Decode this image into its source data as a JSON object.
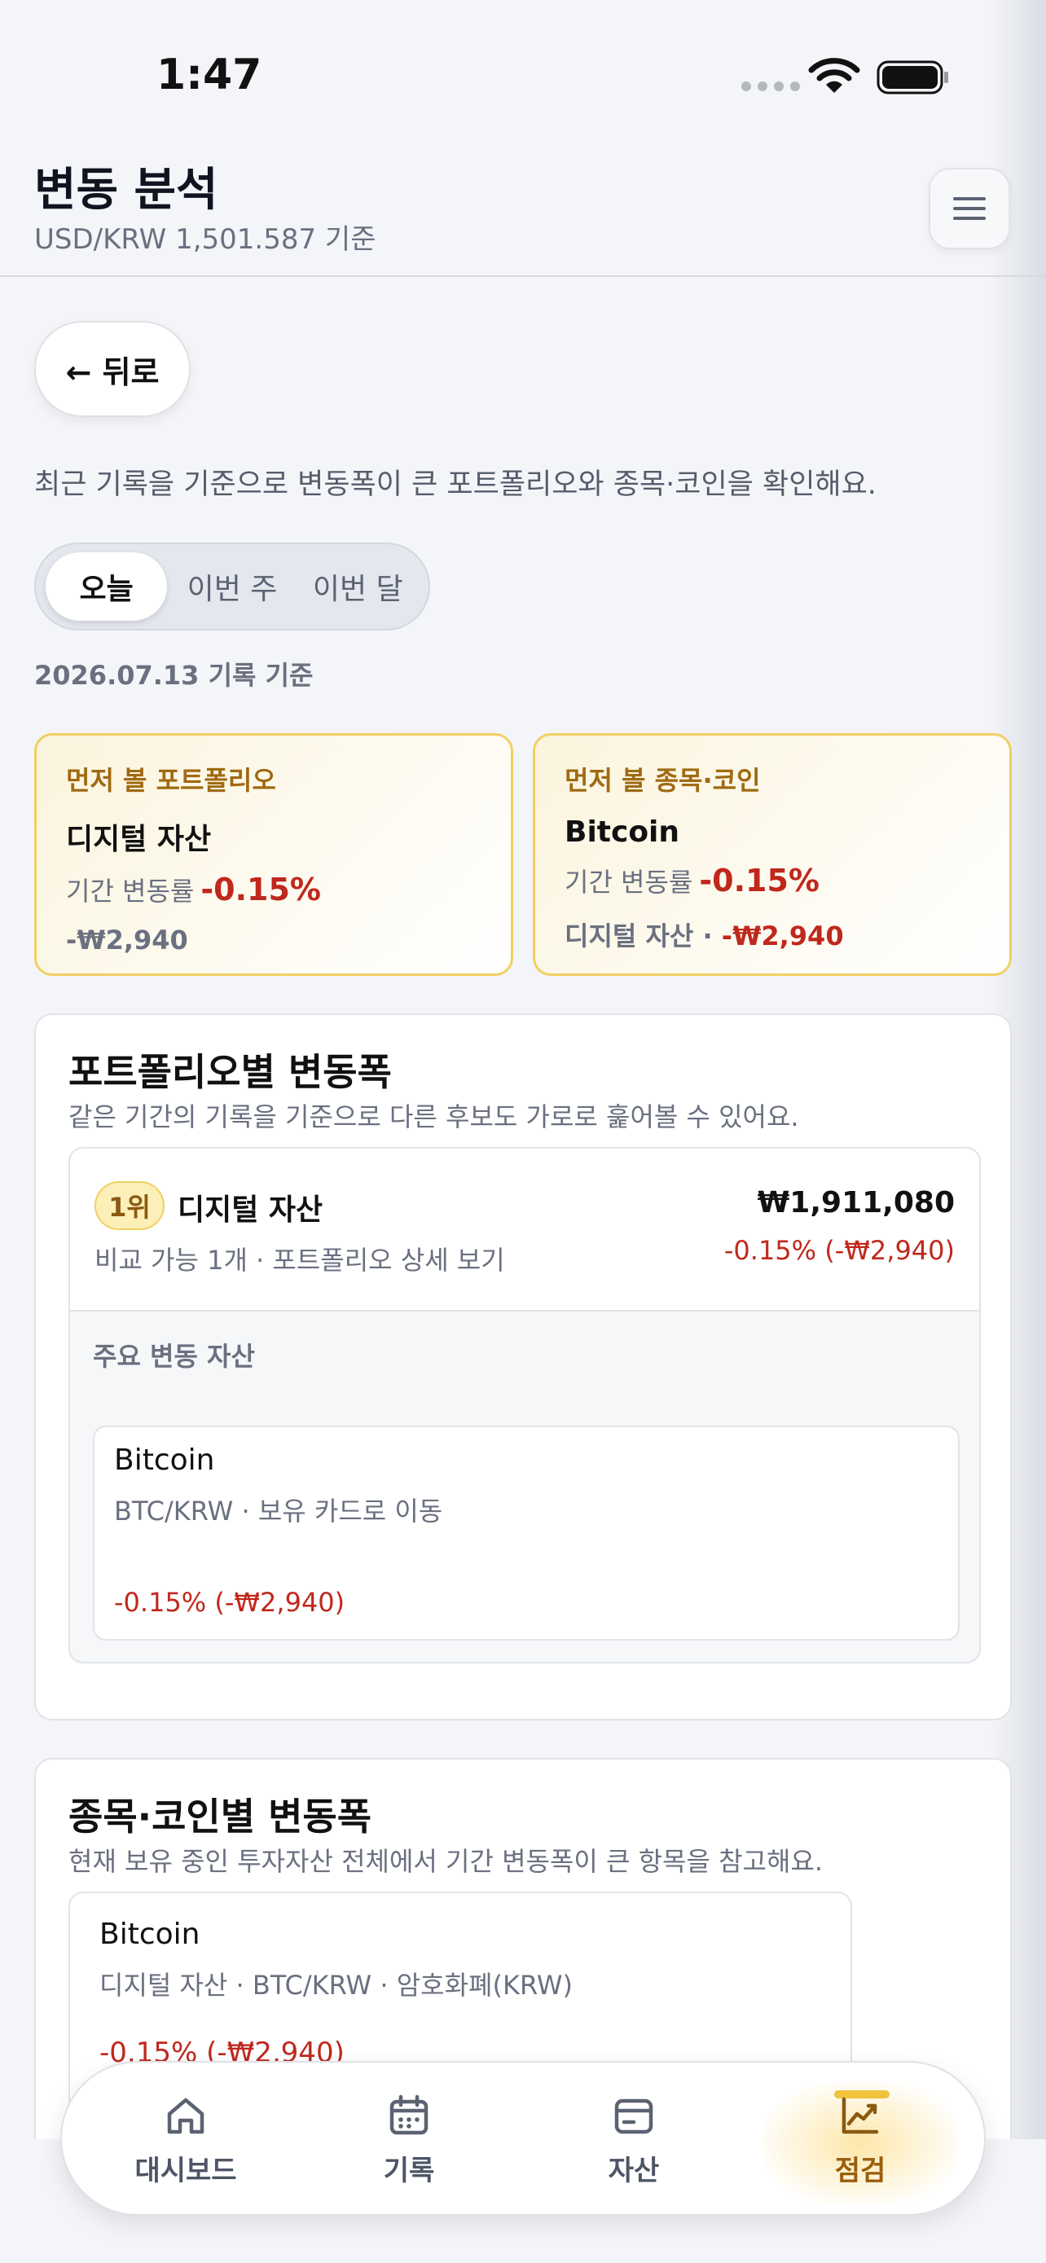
{
  "status_bar": {
    "time": "1:47"
  },
  "header": {
    "title": "변동 분석",
    "subtitle": "USD/KRW 1,501.587 기준"
  },
  "back_label": "← 뒤로",
  "description": "최근 기록을 기준으로 변동폭이 큰 포트폴리오와 종목·코인을 확인해요.",
  "period_tabs": [
    "오늘",
    "이번 주",
    "이번 달"
  ],
  "date_note": "2026.07.13 기록 기준",
  "highlights": {
    "portfolio": {
      "kicker": "먼저 볼 포트폴리오",
      "name": "디지털 자산",
      "rate_label": "기간 변동률",
      "rate": "-0.15%",
      "amount": "-₩2,940"
    },
    "asset": {
      "kicker": "먼저 볼 종목·코인",
      "name": "Bitcoin",
      "rate_label": "기간 변동률",
      "rate": "-0.15%",
      "group": "디지털 자산 · ",
      "amount": "-₩2,940"
    }
  },
  "portfolio_section": {
    "title": "포트폴리오별 변동폭",
    "subtitle": "같은 기간의 기록을 기준으로 다른 후보도 가로로 훑어볼 수 있어요.",
    "rank": {
      "badge": "1위",
      "name": "디지털 자산",
      "meta": "비교 가능 1개 · 포트폴리오 상세 보기",
      "total": "₩1,911,080",
      "change": "-0.15% (-₩2,940)",
      "movers_label": "주요 변동 자산",
      "mover": {
        "name": "Bitcoin",
        "meta": "BTC/KRW · 보유 카드로 이동",
        "change": "-0.15% (-₩2,940)"
      }
    }
  },
  "asset_section": {
    "title": "종목·코인별 변동폭",
    "subtitle": "현재 보유 중인 투자자산 전체에서 기간 변동폭이 큰 항목을 참고해요.",
    "item": {
      "name": "Bitcoin",
      "meta": "디지털 자산 · BTC/KRW · 암호화폐(KRW)",
      "change": "-0.15% (-₩2,940)"
    }
  },
  "tabbar": {
    "items": [
      {
        "label": "대시보드",
        "icon": "home-icon"
      },
      {
        "label": "기록",
        "icon": "calendar-icon"
      },
      {
        "label": "자산",
        "icon": "wallet-icon"
      },
      {
        "label": "점검",
        "icon": "chart-icon"
      }
    ],
    "active": "점검"
  },
  "colors": {
    "accent": "#f1c23c",
    "negative": "#c0281d",
    "highlight_border": "#f1cf64"
  }
}
